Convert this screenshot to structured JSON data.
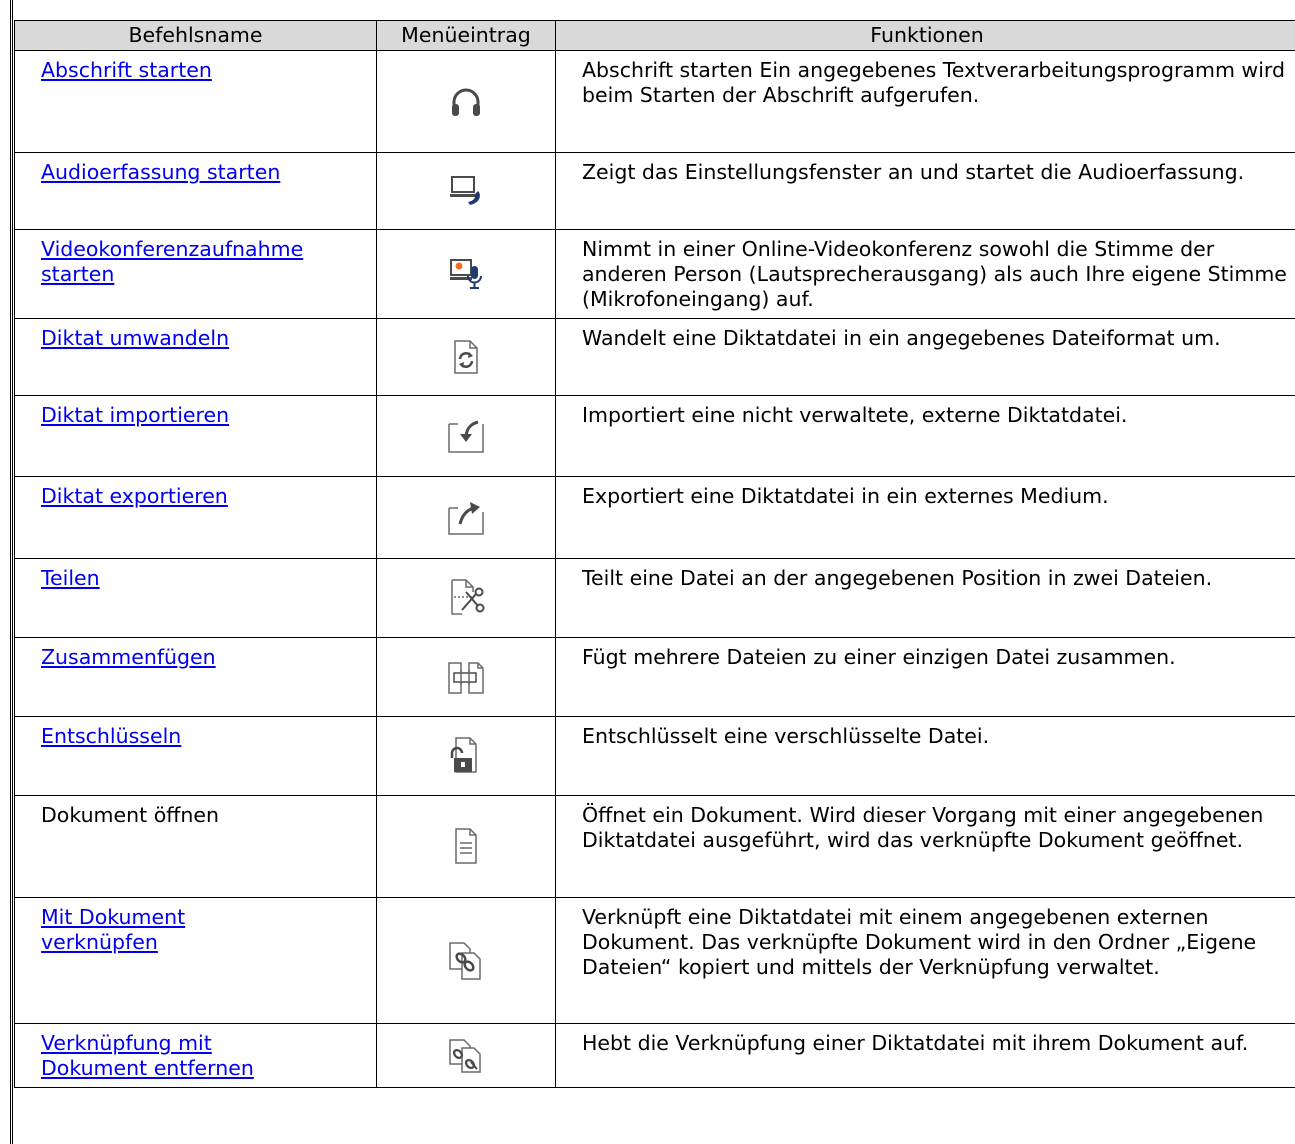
{
  "table": {
    "headers": {
      "name": "Befehlsname",
      "menu": "Menüeintrag",
      "function": "Funktionen"
    },
    "rows": [
      {
        "name": "Abschrift starten",
        "linked": true,
        "icon": "headphones-icon",
        "function": "Abschrift starten Ein angegebenes Textverarbeitungsprogramm wird beim Starten der Abschrift aufgerufen."
      },
      {
        "name": "Audioerfassung starten",
        "linked": true,
        "icon": "computer-phone-icon",
        "function": "Zeigt das Einstellungsfenster an und startet die Audioerfassung."
      },
      {
        "name": "Videokonferenzaufnahme starten",
        "linked": true,
        "icon": "video-conference-microphone-icon",
        "function": "Nimmt in einer Online-Videokonferenz sowohl die Stimme der anderen Person (Lautsprecherausgang) als auch Ihre eigene Stimme (Mikrofoneingang) auf."
      },
      {
        "name": "Diktat umwandeln",
        "linked": true,
        "icon": "convert-file-icon",
        "function": "Wandelt eine Diktatdatei in ein angegebenes Dateiformat um."
      },
      {
        "name": "Diktat importieren",
        "linked": true,
        "icon": "import-tray-icon",
        "function": "Importiert eine nicht verwaltete, externe Diktatdatei."
      },
      {
        "name": "Diktat exportieren",
        "linked": true,
        "icon": "export-tray-icon",
        "function": "Exportiert eine Diktatdatei in ein externes Medium."
      },
      {
        "name": "Teilen",
        "linked": true,
        "icon": "split-scissors-icon",
        "function": "Teilt eine Datei an der angegebenen Position in zwei Dateien."
      },
      {
        "name": "Zusammenfügen",
        "linked": true,
        "icon": "join-files-icon",
        "function": "Fügt mehrere Dateien zu einer einzigen Datei zusammen."
      },
      {
        "name": "Entschlüsseln",
        "linked": true,
        "icon": "unlock-file-icon",
        "function": "Entschlüsselt eine verschlüsselte Datei."
      },
      {
        "name": "Dokument öffnen",
        "linked": false,
        "icon": "document-icon",
        "function": "Öffnet ein Dokument. Wird dieser Vorgang mit einer angegebenen Diktatdatei ausgeführt, wird das verknüpfte Dokument geöffnet."
      },
      {
        "name": "Mit Dokument verknüpfen",
        "linked": true,
        "icon": "link-document-icon",
        "function": "Verknüpft eine Diktatdatei mit einem angegebenen externen Dokument. Das verknüpfte Dokument wird in den Ordner „Eigene Dateien“ kopiert und mittels der Verknüpfung verwaltet."
      },
      {
        "name": "Verknüpfung mit Dokument entfernen",
        "linked": true,
        "icon": "unlink-document-icon",
        "function": "Hebt die Verknüpfung einer Diktatdatei mit ihrem Dokument auf."
      }
    ]
  }
}
